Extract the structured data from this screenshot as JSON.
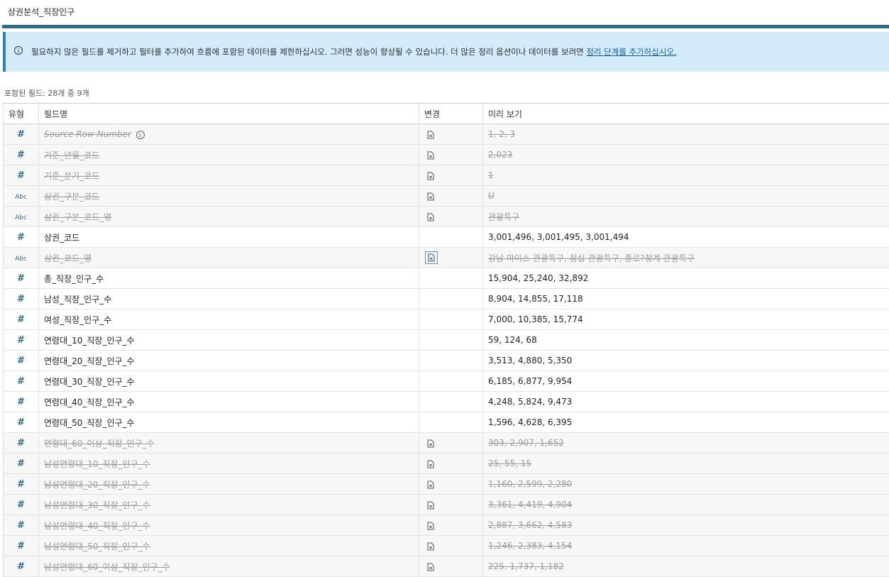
{
  "window": {
    "title": "상권분석_직장인구"
  },
  "banner": {
    "message": "필요하지 않은 필드를 제거하고 필터를 추가하여 흐름에 포함된 데이터를 제한하십시오. 그러면 성능이 향상될 수 있습니다. 더 많은 정리 옵션이나 데이터를 보려면 ",
    "link_text": "정리 단계를 추가하십시오."
  },
  "summary": {
    "included_count": "포함된 필드: 28개 중 9개"
  },
  "table": {
    "headers": {
      "type": "유형",
      "field_name": "필드명",
      "change": "변경",
      "preview": "미리 보기"
    },
    "rows": [
      {
        "type": "number",
        "name": "Source Row Number",
        "preview": "1, 2, 3",
        "included": false
      },
      {
        "type": "number",
        "name": "기준_년월_코드",
        "preview": "2,023",
        "included": false
      },
      {
        "type": "number",
        "name": "기준_분기_코드",
        "preview": "1",
        "included": false
      },
      {
        "type": "string",
        "name": "상권_구분_코드",
        "preview": "U",
        "included": false
      },
      {
        "type": "string",
        "name": "상권_구분_코드_명",
        "preview": "관광특구",
        "included": false
      },
      {
        "type": "number",
        "name": "상권_코드",
        "preview": "3,001,496, 3,001,495, 3,001,494",
        "included": true
      },
      {
        "type": "string",
        "name": "상권_코드_명",
        "preview": "강남 마이스 관광특구, 잠실 관광특구, 종로?청계 관광특구",
        "included": false
      },
      {
        "type": "number",
        "name": "총_직장_인구_수",
        "preview": "15,904, 25,240, 32,892",
        "included": true
      },
      {
        "type": "number",
        "name": "남성_직장_인구_수",
        "preview": "8,904, 14,855, 17,118",
        "included": true
      },
      {
        "type": "number",
        "name": "여성_직장_인구_수",
        "preview": "7,000, 10,385, 15,774",
        "included": true
      },
      {
        "type": "number",
        "name": "연령대_10_직장_인구_수",
        "preview": "59, 124, 68",
        "included": true
      },
      {
        "type": "number",
        "name": "연령대_20_직장_인구_수",
        "preview": "3,513, 4,880, 5,350",
        "included": true
      },
      {
        "type": "number",
        "name": "연령대_30_직장_인구_수",
        "preview": "6,185, 6,877, 9,954",
        "included": true
      },
      {
        "type": "number",
        "name": "연령대_40_직장_인구_수",
        "preview": "4,248, 5,824, 9,473",
        "included": true
      },
      {
        "type": "number",
        "name": "연령대_50_직장_인구_수",
        "preview": "1,596, 4,628, 6,395",
        "included": true
      },
      {
        "type": "number",
        "name": "연령대_60_이상_직장_인구_수",
        "preview": "303, 2,907, 1,652",
        "included": false
      },
      {
        "type": "number",
        "name": "남성연령대_10_직장_인구_수",
        "preview": "25, 55, 15",
        "included": false
      },
      {
        "type": "number",
        "name": "남성연령대_20_직장_인구_수",
        "preview": "1,160, 2,599, 2,280",
        "included": false
      },
      {
        "type": "number",
        "name": "남성연령대_30_직장_인구_수",
        "preview": "3,361, 4,419, 4,904",
        "included": false
      },
      {
        "type": "number",
        "name": "남성연령대_40_직장_인구_수",
        "preview": "2,887, 3,662, 4,583",
        "included": false
      },
      {
        "type": "number",
        "name": "남성연령대_50_직장_인구_수",
        "preview": "1,246, 2,383, 4,154",
        "included": false
      },
      {
        "type": "number",
        "name": "남성연령대_60_이상_직장_인구_수",
        "preview": "225, 1,737, 1,182",
        "included": false
      }
    ]
  },
  "icons": {
    "number_type": "hash-icon",
    "string_type": "abc-icon",
    "number_glyph": "#",
    "string_glyph": "Abc",
    "change": "remove-field-icon",
    "info": "info-icon"
  },
  "colors": {
    "accent_bar": "#2e6b8a",
    "banner_bg": "#d4ebfa",
    "link": "#1b5f9e",
    "type_icon": "#2f6f93"
  }
}
